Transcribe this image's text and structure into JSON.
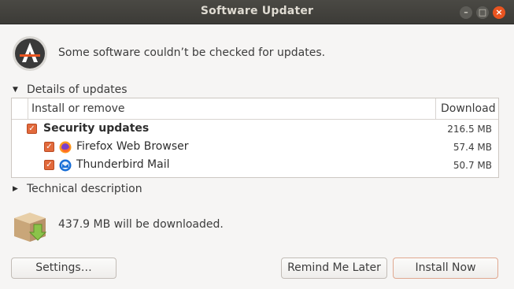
{
  "window": {
    "title": "Software Updater",
    "controls": {
      "minimize": "–",
      "maximize": "□",
      "close": "×"
    }
  },
  "status": {
    "icon": "software-updater-icon",
    "message": "Some software couldn’t be checked for updates."
  },
  "details": {
    "label": "Details of updates",
    "expanded": true,
    "columns": {
      "name": "Install or remove",
      "download": "Download"
    },
    "rows": [
      {
        "label": "Security updates",
        "size": "216.5 MB",
        "checked": true,
        "bold": true,
        "icon": ""
      },
      {
        "label": "Firefox Web Browser",
        "size": "57.4 MB",
        "checked": true,
        "bold": false,
        "icon": "firefox-icon"
      },
      {
        "label": "Thunderbird Mail",
        "size": "50.7 MB",
        "checked": true,
        "bold": false,
        "icon": "thunderbird-icon"
      }
    ]
  },
  "technical": {
    "label": "Technical description",
    "expanded": false
  },
  "download": {
    "icon": "package-download-icon",
    "text": "437.9 MB will be downloaded."
  },
  "buttons": {
    "settings": "Settings…",
    "remind": "Remind Me Later",
    "install": "Install Now"
  },
  "colors": {
    "accent": "#e95420",
    "checkbox": "#e26a3c",
    "titlebar": "#3c3b37"
  }
}
